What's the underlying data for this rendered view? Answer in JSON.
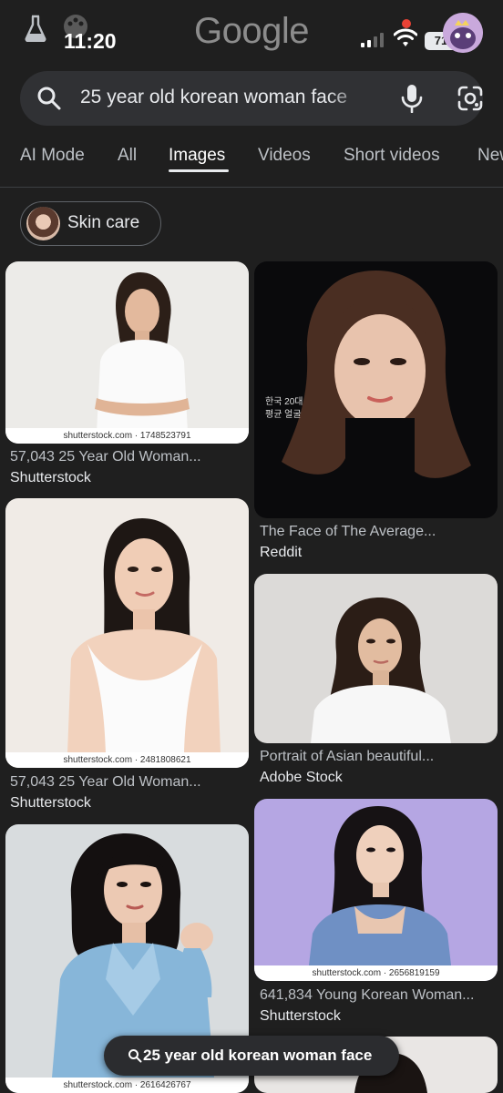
{
  "status_bar": {
    "time": "11:20",
    "battery": "71",
    "icons": [
      "lab-icon",
      "palette-icon",
      "signal-icon",
      "wifi-icon",
      "battery-icon",
      "avatar"
    ]
  },
  "app": {
    "logo": "Google"
  },
  "search": {
    "query": "25 year old korean woman face",
    "icons": [
      "search-icon",
      "mic-icon",
      "lens-icon"
    ]
  },
  "tabs": [
    {
      "label": "AI Mode"
    },
    {
      "label": "All"
    },
    {
      "label": "Images",
      "active": true
    },
    {
      "label": "Videos"
    },
    {
      "label": "Short videos"
    },
    {
      "label": "News"
    }
  ],
  "chips": [
    {
      "label": "Skin care"
    }
  ],
  "results": [
    {
      "title": "57,043 25 Year Old Woman...",
      "source": "Shutterstock",
      "watermark": "shutterstock.com · 1748523791"
    },
    {
      "title": "The Face of The Average...",
      "source": "Reddit",
      "overlay_text": "한국 20대 평균 얼굴"
    },
    {
      "title": "57,043 25 Year Old Woman...",
      "source": "Shutterstock",
      "watermark": "shutterstock.com · 2481808621"
    },
    {
      "title": "Portrait of Asian beautiful...",
      "source": "Adobe Stock"
    },
    {
      "title": "641,834 Young Korean Woman...",
      "source": "Shutterstock",
      "watermark": "shutterstock.com · 2656819159"
    },
    {
      "title": "",
      "source": "",
      "watermark": "shutterstock.com · 2616426767"
    }
  ],
  "floating_query": {
    "text": "25 year old korean woman face"
  },
  "colors": {
    "background": "#1f1f1f",
    "search_bg": "#303134",
    "recording_dot": "#e94235"
  }
}
